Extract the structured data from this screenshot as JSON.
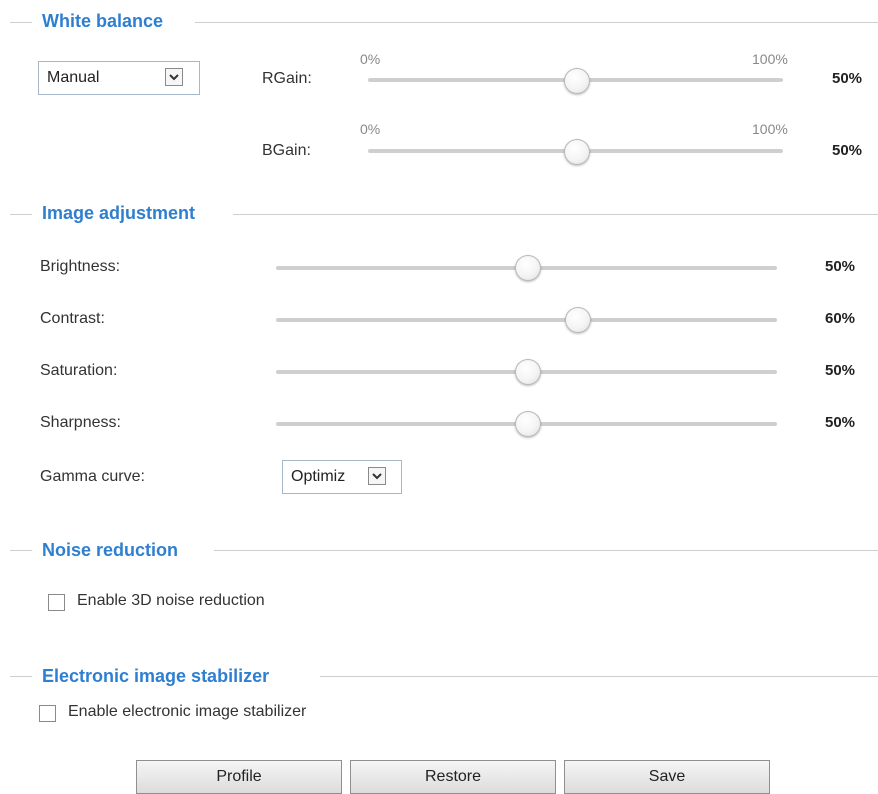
{
  "white_balance": {
    "title": "White balance",
    "mode_value": "Manual",
    "rgain": {
      "label": "RGain:",
      "min_label": "0%",
      "max_label": "100%",
      "value_text": "50%",
      "level": 0.5
    },
    "bgain": {
      "label": "BGain:",
      "min_label": "0%",
      "max_label": "100%",
      "value_text": "50%",
      "level": 0.5
    }
  },
  "image_adjustment": {
    "title": "Image adjustment",
    "brightness": {
      "label": "Brightness:",
      "value_text": "50%",
      "level": 0.5
    },
    "contrast": {
      "label": "Contrast:",
      "value_text": "60%",
      "level": 0.6
    },
    "saturation": {
      "label": "Saturation:",
      "value_text": "50%",
      "level": 0.5
    },
    "sharpness": {
      "label": "Sharpness:",
      "value_text": "50%",
      "level": 0.5
    },
    "gamma": {
      "label": "Gamma curve:",
      "value": "Optimiz"
    }
  },
  "noise_reduction": {
    "title": "Noise reduction",
    "checkbox_label": "Enable 3D noise reduction",
    "checked": false
  },
  "eis": {
    "title": "Electronic image stabilizer",
    "checkbox_label": "Enable electronic image stabilizer",
    "checked": false
  },
  "buttons": {
    "profile": "Profile",
    "restore": "Restore",
    "save": "Save"
  },
  "colors": {
    "accent": "#2f7fd0"
  }
}
